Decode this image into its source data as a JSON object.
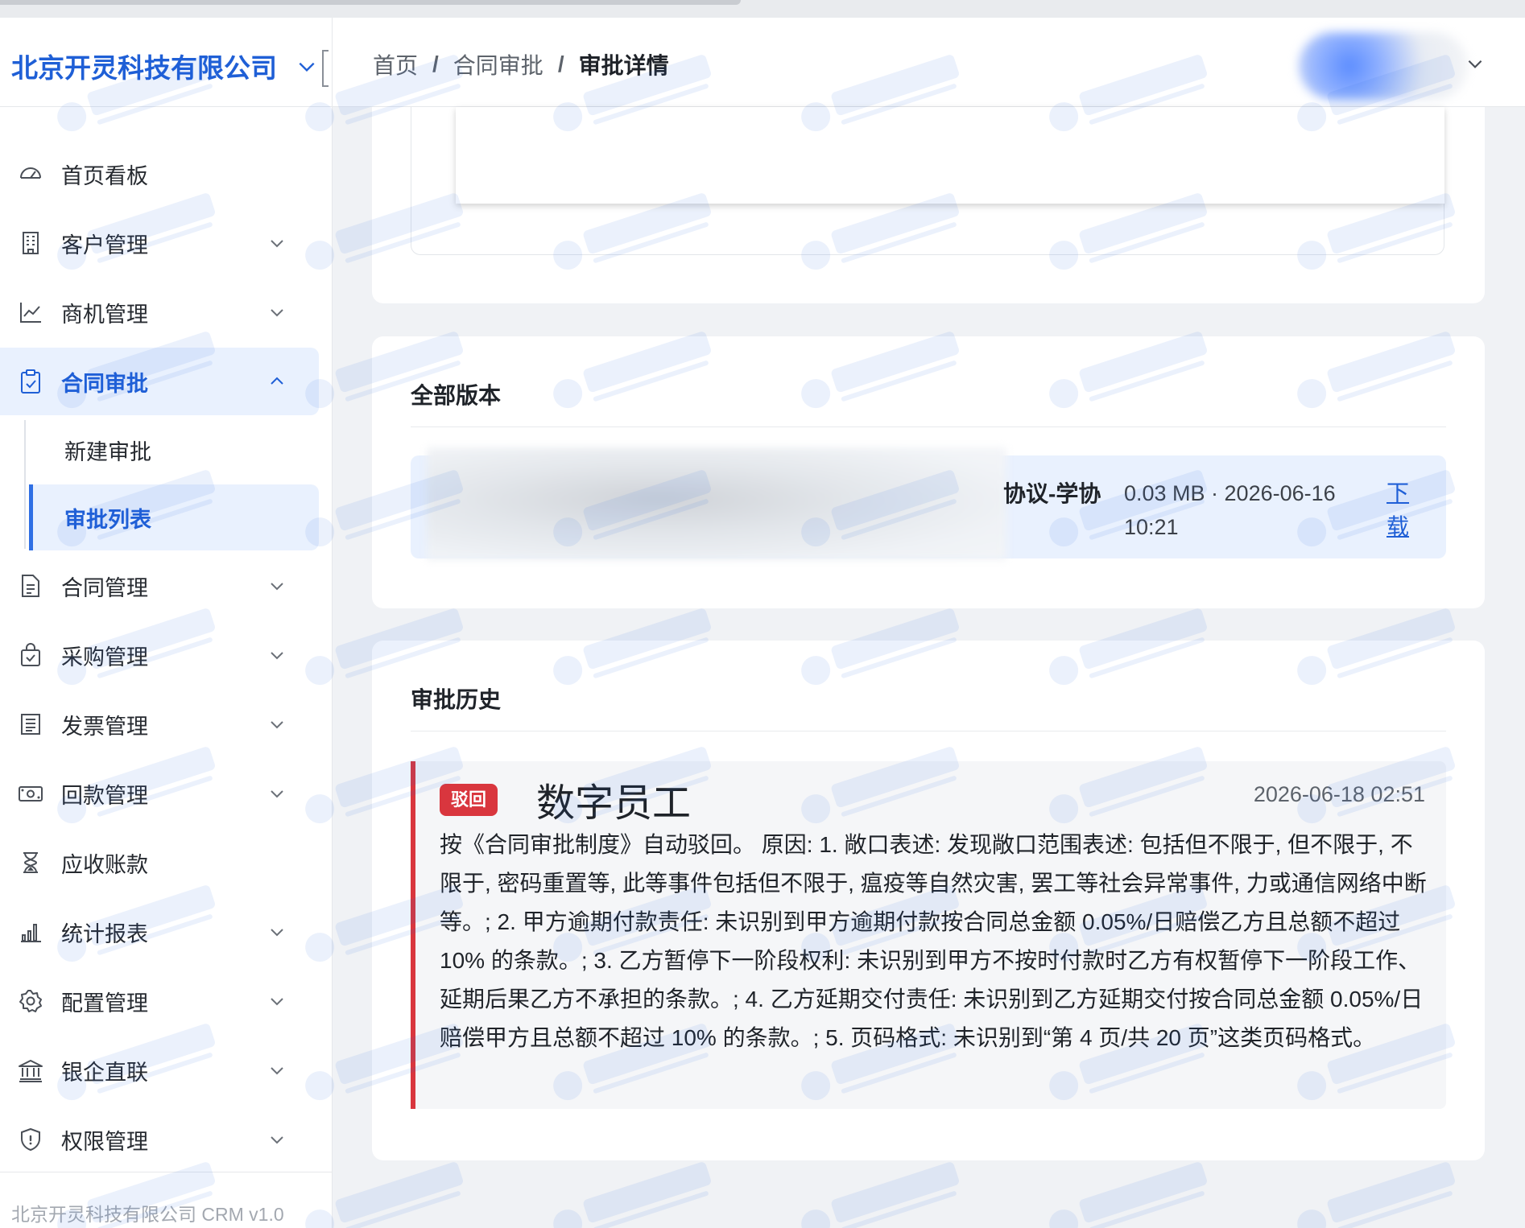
{
  "brand": {
    "name": "北京开灵科技有限公司"
  },
  "breadcrumb": {
    "home": "首页",
    "section": "合同审批",
    "current": "审批详情"
  },
  "sidebar": {
    "items": [
      {
        "label": "首页看板",
        "icon": "dashboard-icon",
        "has_children": false
      },
      {
        "label": "客户管理",
        "icon": "building-icon",
        "has_children": true
      },
      {
        "label": "商机管理",
        "icon": "trend-chart-icon",
        "has_children": true
      },
      {
        "label": "合同审批",
        "icon": "clipboard-check-icon",
        "has_children": true,
        "expanded": true,
        "active": true,
        "children": [
          {
            "label": "新建审批",
            "active": false
          },
          {
            "label": "审批列表",
            "active": true
          }
        ]
      },
      {
        "label": "合同管理",
        "icon": "document-icon",
        "has_children": true
      },
      {
        "label": "采购管理",
        "icon": "shopping-bag-icon",
        "has_children": true
      },
      {
        "label": "发票管理",
        "icon": "invoice-icon",
        "has_children": true
      },
      {
        "label": "回款管理",
        "icon": "cash-icon",
        "has_children": true
      },
      {
        "label": "应收账款",
        "icon": "hourglass-icon",
        "has_children": false
      },
      {
        "label": "统计报表",
        "icon": "bar-chart-icon",
        "has_children": true
      },
      {
        "label": "配置管理",
        "icon": "gear-icon",
        "has_children": true
      },
      {
        "label": "银企直联",
        "icon": "bank-icon",
        "has_children": true
      },
      {
        "label": "权限管理",
        "icon": "shield-icon",
        "has_children": true
      }
    ],
    "footer": "北京开灵科技有限公司 CRM v1.0"
  },
  "versions": {
    "title": "全部版本",
    "files": [
      {
        "name_visible": "协议-学协",
        "size_date": "0.03 MB · 2026-06-16 10:21",
        "download_label": "下载"
      }
    ]
  },
  "history": {
    "title": "审批历史",
    "entries": [
      {
        "status": "驳回",
        "actor": "数字员工",
        "time": "2026-06-18 02:51",
        "comment": "按《合同审批制度》自动驳回。 原因: 1. 敞口表述: 发现敞口范围表述: 包括但不限于, 但不限于, 不限于, 密码重置等, 此等事件包括但不限于, 瘟疫等自然灾害, 罢工等社会异常事件, 力或通信网络中断等。; 2. 甲方逾期付款责任: 未识别到甲方逾期付款按合同总金额 0.05%/日赔偿乙方且总额不超过 10% 的条款。; 3. 乙方暂停下一阶段权利: 未识别到甲方不按时付款时乙方有权暂停下一阶段工作、延期后果乙方不承担的条款。; 4. 乙方延期交付责任: 未识别到乙方延期交付按合同总金额 0.05%/日赔偿甲方且总额不超过 10% 的条款。; 5. 页码格式: 未识别到“第 4 页/共 20 页”这类页码格式。"
      }
    ]
  },
  "colors": {
    "primary": "#1f5fd6",
    "active_bg": "#e9f1fe",
    "reject": "#d9363e"
  }
}
